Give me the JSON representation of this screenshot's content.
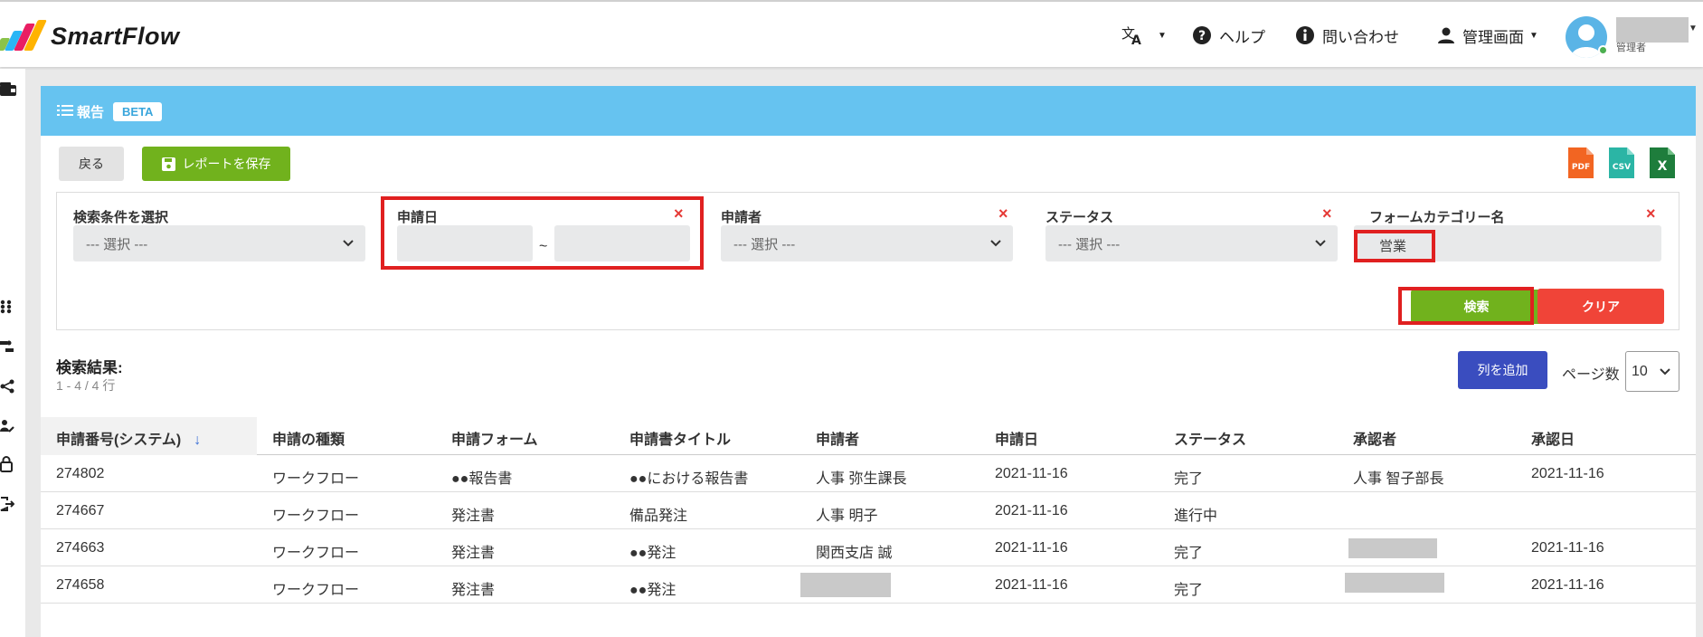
{
  "header": {
    "logo_text": "SmartFlow",
    "nav": {
      "help": "ヘルプ",
      "contact": "問い合わせ",
      "admin": "管理画面"
    },
    "user_role": "管理者"
  },
  "panel": {
    "title": "報告",
    "badge": "BETA",
    "back_label": "戻る",
    "save_label": "レポートを保存",
    "exports": [
      "PDF",
      "CSV",
      "X"
    ]
  },
  "filters": {
    "condition": {
      "label": "検索条件を選択",
      "value": "--- 選択 ---"
    },
    "date": {
      "label": "申請日",
      "separator": "~"
    },
    "applicant": {
      "label": "申請者",
      "value": "--- 選択 ---"
    },
    "status": {
      "label": "ステータス",
      "value": "--- 選択 ---"
    },
    "category": {
      "label": "フォームカテゴリー名",
      "value": "営業"
    },
    "remove_icon": "×",
    "search_label": "検索",
    "clear_label": "クリア"
  },
  "results": {
    "title": "検索結果:",
    "count": "1 - 4 / 4 行",
    "add_columns_label": "列を追加",
    "page_size_label": "ページ数",
    "page_size": "10"
  },
  "table": {
    "columns": [
      "申請番号(システム)",
      "申請の種類",
      "申請フォーム",
      "申請書タイトル",
      "申請者",
      "申請日",
      "ステータス",
      "承認者",
      "承認日"
    ],
    "sort_indicator": "↓",
    "rows": [
      [
        "274802",
        "ワークフロー",
        "●●報告書",
        "●●における報告書",
        "人事 弥生課長",
        "2021-11-16",
        "完了",
        "人事 智子部長",
        "2021-11-16"
      ],
      [
        "274667",
        "ワークフロー",
        "発注書",
        "備品発注",
        "人事 明子",
        "2021-11-16",
        "進行中",
        "",
        ""
      ],
      [
        "274663",
        "ワークフロー",
        "発注書",
        "●●発注",
        "関西支店 誠",
        "2021-11-16",
        "完了",
        "",
        "2021-11-16"
      ],
      [
        "274658",
        "ワークフロー",
        "発注書",
        "●●発注",
        "",
        "2021-11-16",
        "完了",
        "",
        "2021-11-16"
      ]
    ]
  },
  "colors": {
    "header_blue": "#66c3f0",
    "green": "#71b21d",
    "red": "#f04438",
    "indigo": "#3a4dbf",
    "highlight_red": "#e02020"
  }
}
